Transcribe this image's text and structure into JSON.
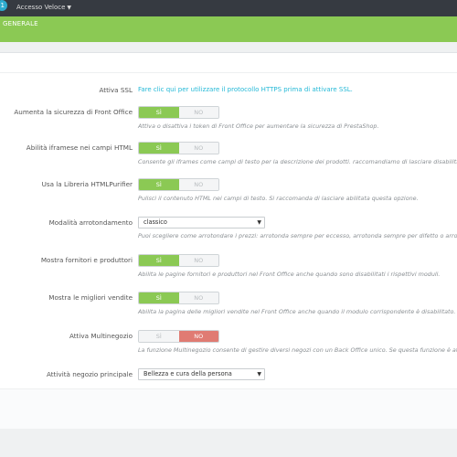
{
  "topbar": {
    "notification_count": "1",
    "quick_access": "Accesso Veloce"
  },
  "tabbar": {
    "active_tab": "GENERALE"
  },
  "settings": {
    "ssl": {
      "label": "Attiva SSL",
      "link": "Fare clic qui per utilizzare il protocollo HTTPS prima di attivare SSL."
    },
    "front_security": {
      "label": "Aumenta la sicurezza di Front Office",
      "yes": "SÌ",
      "no": "NO",
      "value": "yes",
      "help": "Attiva o disattiva i token di Front Office per aumentare la sicurezza di PrestaShop."
    },
    "iframes": {
      "label": "Abilità iframese nei campi HTML",
      "yes": "SÌ",
      "no": "NO",
      "value": "yes",
      "help": "Consente gli iframes come campi di testo per la descrizione dei prodotti. raccomandiamo di lasciare disabilitata"
    },
    "htmlpurifier": {
      "label": "Usa la Libreria HTMLPurifier",
      "yes": "SÌ",
      "no": "NO",
      "value": "yes",
      "help": "Pulisci il contenuto HTML nei campi di testo. Si raccomanda di lasciare abilitata questa opzione."
    },
    "rounding": {
      "label": "Modalità arrotondamento",
      "selected": "classico",
      "help": "Puoi scegliere come arrotondare i prezzi: arrotonda sempre per eccesso, arrotonda sempre per difetto o arrotonda"
    },
    "suppliers": {
      "label": "Mostra fornitori e produttori",
      "yes": "SÌ",
      "no": "NO",
      "value": "yes",
      "help": "Abilita le pagine fornitori e produttori nel Front Office anche quando sono disabilitati i rispettivi moduli."
    },
    "bestsales": {
      "label": "Mostra le migliori vendite",
      "yes": "SÌ",
      "no": "NO",
      "value": "yes",
      "help": "Abilita la pagina delle migliori vendite nel Front Office anche quando il modulo corrispondente è disabilitato."
    },
    "multistore": {
      "label": "Attiva Multinegozio",
      "yes": "SÌ",
      "no": "NO",
      "value": "no",
      "help": "La funzione Multinegozio consente di gestire diversi negozi con un Back Office unico. Se questa funzione è attiva"
    },
    "main_activity": {
      "label": "Attività negozio principale",
      "selected": "Bellezza e cura della persona"
    }
  },
  "colors": {
    "accent_green": "#8bc954",
    "topbar": "#363a41",
    "link": "#25b9d7",
    "no_active": "#e07b73"
  }
}
